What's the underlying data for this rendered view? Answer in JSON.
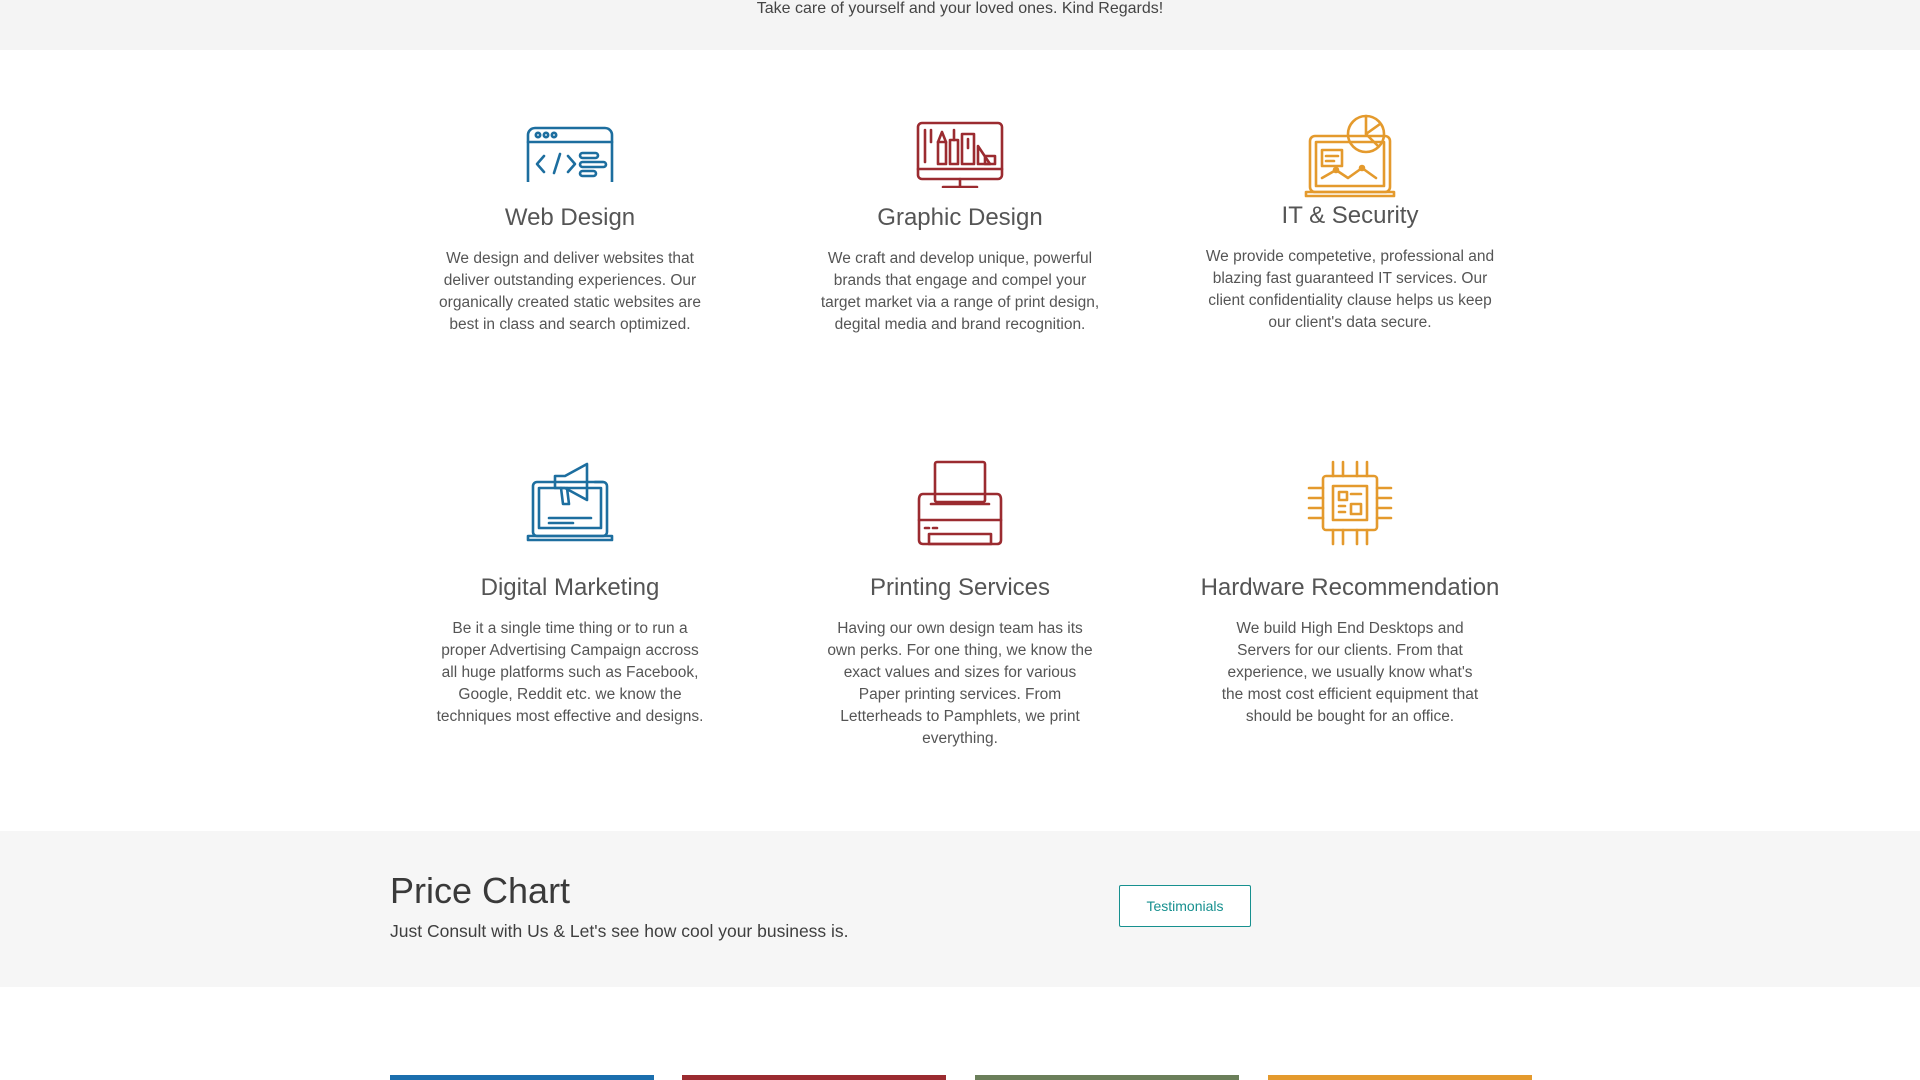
{
  "top_band": {
    "text": "Take care of yourself and your loved ones. Kind Regards!"
  },
  "services": [
    {
      "title": "Web Design",
      "icon": "web-design-icon",
      "color": "#1d6e9f",
      "text": "We design and deliver websites that deliver outstanding experiences. Our organically created static websites are best in class and search optimized."
    },
    {
      "title": "Graphic Design",
      "icon": "graphic-design-icon",
      "color": "#9b2b30",
      "text": "We craft and develop unique, powerful brands that engage and compel your target market via a range of print design, degital media and brand recognition."
    },
    {
      "title": "IT & Security",
      "icon": "it-security-icon",
      "color": "#e49a2d",
      "text": "We provide competetive, professional and blazing fast guaranteed IT services. Our client confidentiality clause helps us keep our client's data secure."
    },
    {
      "title": "Digital Marketing",
      "icon": "digital-marketing-icon",
      "color": "#1d6e9f",
      "text": "Be it a single time thing or to run a proper Advertising Campaign accross all huge platforms such as Facebook, Google, Reddit etc. we know the techniques most effective and designs."
    },
    {
      "title": "Printing Services",
      "icon": "printer-icon",
      "color": "#9b2b30",
      "text": "Having our own design team has its own perks. For one thing, we know the exact values and sizes for various Paper printing services. From Letterheads to Pamphlets, we print everything."
    },
    {
      "title": "Hardware Recommendation",
      "icon": "chip-icon",
      "color": "#e49a2d",
      "text": "We build High End Desktops and Servers for our clients. From that experience, we usually know what's the most cost efficient equipment that should be bought for an office."
    }
  ],
  "price_chart": {
    "title": "Price Chart",
    "subtitle": "Just Consult with Us & Let's see how cool your business is.",
    "button_label": "Testimonials",
    "button_color": "#17908f"
  },
  "plan_colors": [
    "#1b6fae",
    "#9b2b30",
    "#6b7f5a",
    "#e49a2d"
  ]
}
